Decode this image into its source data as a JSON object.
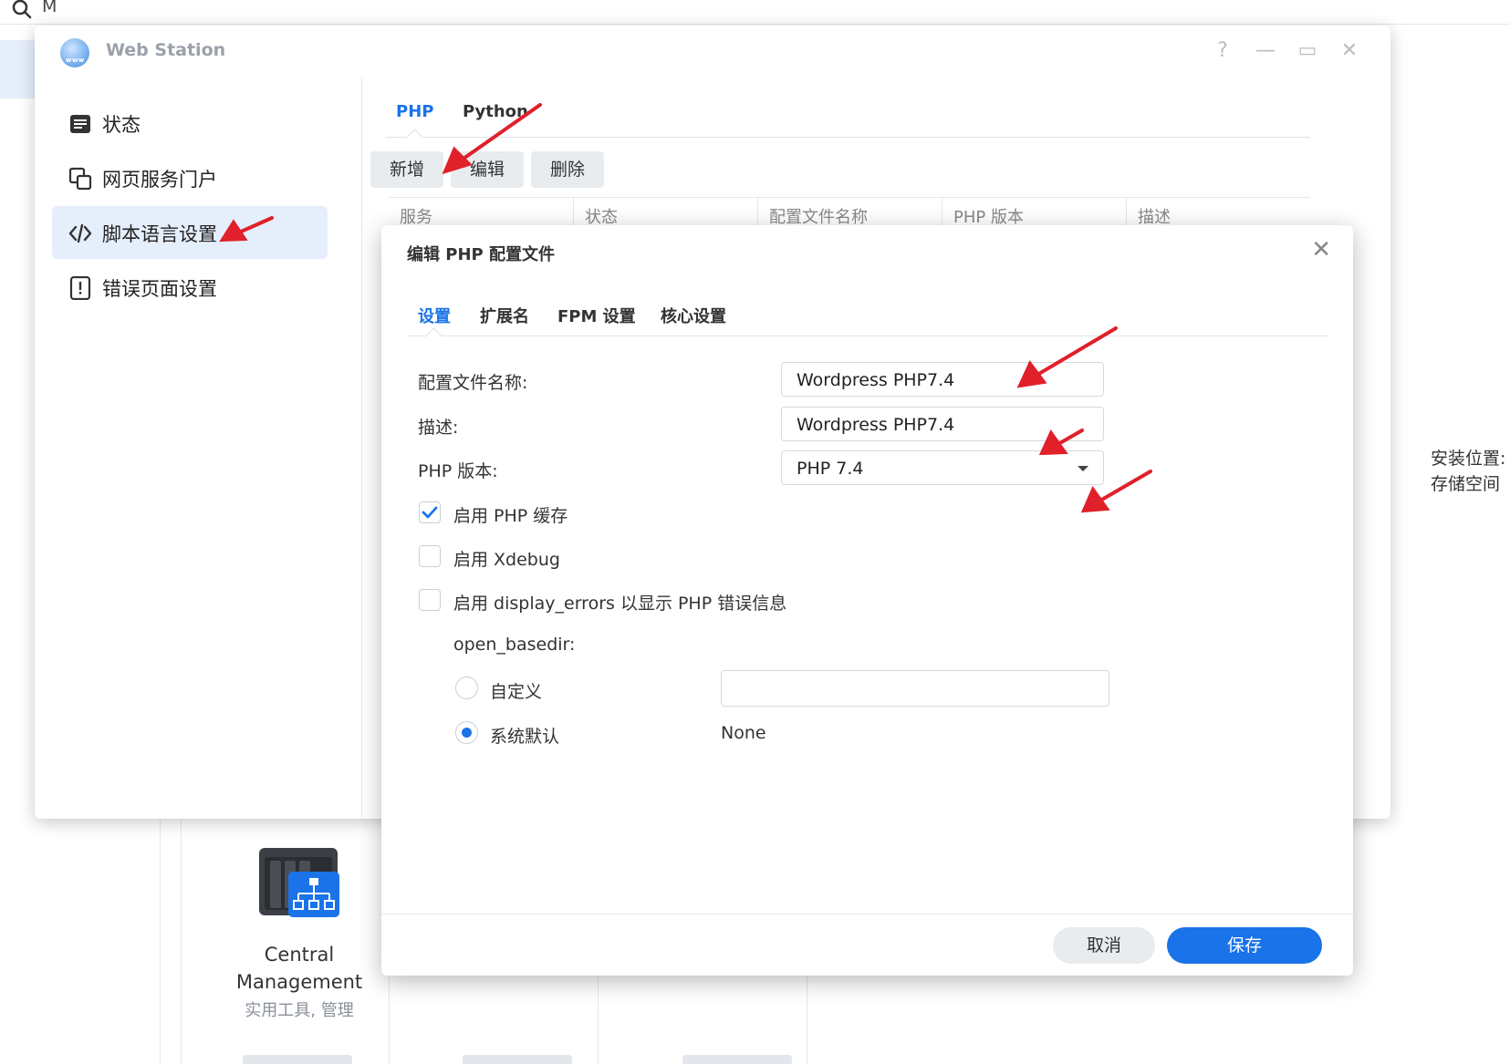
{
  "background": {
    "search_text": "M",
    "card_title_line1": "Central",
    "card_title_line2": "Management",
    "card_subtitle": "实用工具, 管理",
    "right_text_1": "安装位置:",
    "right_text_2": "存储空间"
  },
  "window": {
    "title": "Web Station",
    "controls": {
      "help": "?",
      "minimize": "—",
      "maximize": "▭",
      "close": "✕"
    }
  },
  "sidebar": {
    "items": [
      {
        "label": "状态",
        "icon": "status-icon"
      },
      {
        "label": "网页服务门户",
        "icon": "portal-icon"
      },
      {
        "label": "脚本语言设置",
        "icon": "code-icon"
      },
      {
        "label": "错误页面设置",
        "icon": "error-page-icon"
      }
    ],
    "active_index": 2
  },
  "main": {
    "tabs": [
      {
        "label": "PHP"
      },
      {
        "label": "Python"
      }
    ],
    "toolbar": {
      "add": "新增",
      "edit": "编辑",
      "delete": "删除"
    },
    "columns": [
      "服务",
      "状态",
      "配置文件名称",
      "PHP 版本",
      "描述"
    ]
  },
  "dialog": {
    "title": "编辑 PHP 配置文件",
    "close": "✕",
    "tabs": [
      {
        "label": "设置"
      },
      {
        "label": "扩展名"
      },
      {
        "label": "FPM 设置"
      },
      {
        "label": "核心设置"
      }
    ],
    "fields": {
      "profile_name_label": "配置文件名称:",
      "profile_name_value": "Wordpress PHP7.4",
      "description_label": "描述:",
      "description_value": "Wordpress PHP7.4",
      "php_version_label": "PHP 版本:",
      "php_version_value": "PHP 7.4"
    },
    "checkboxes": [
      {
        "label": "启用 PHP 缓存",
        "checked": true
      },
      {
        "label": "启用 Xdebug",
        "checked": false
      },
      {
        "label": "启用 display_errors 以显示 PHP 错误信息",
        "checked": false
      }
    ],
    "open_basedir": {
      "label": "open_basedir:",
      "custom_label": "自定义",
      "custom_value": "",
      "default_label": "系统默认",
      "default_value": "None",
      "selected": "default"
    },
    "buttons": {
      "cancel": "取消",
      "save": "保存"
    }
  },
  "colors": {
    "accent": "#1a73e8",
    "annotation_arrow": "#e0202a"
  }
}
